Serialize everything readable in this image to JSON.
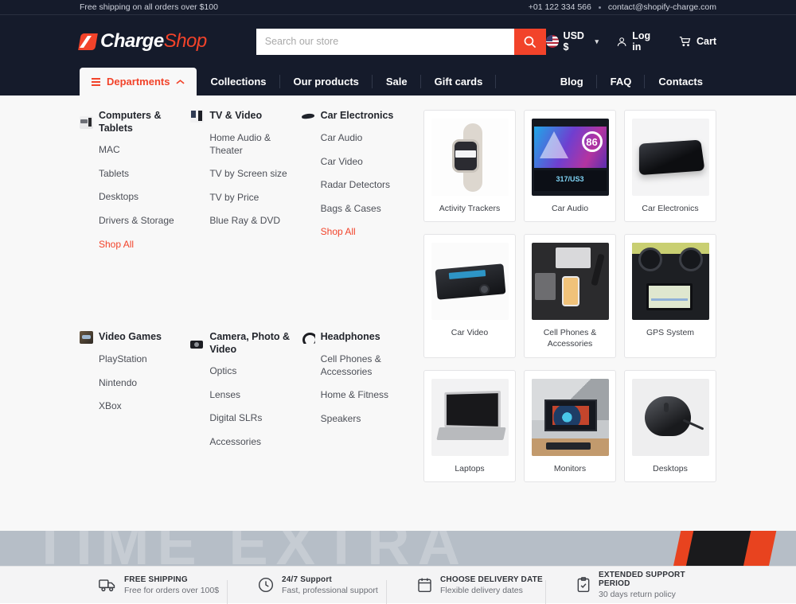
{
  "topbar": {
    "promo": "Free shipping on all orders over $100",
    "phone": "+01 122 334 566",
    "email": "contact@shopify-charge.com"
  },
  "header": {
    "logo_primary": "Charge",
    "logo_secondary": "Shop",
    "search_placeholder": "Search our store",
    "search_value": "",
    "currency": "USD $",
    "login_label": "Log in",
    "cart_label": "Cart"
  },
  "nav": {
    "departments_label": "Departments",
    "left_items": [
      {
        "label": "Collections"
      },
      {
        "label": "Our products"
      },
      {
        "label": "Sale"
      },
      {
        "label": "Gift cards"
      }
    ],
    "right_items": [
      {
        "label": "Blog"
      },
      {
        "label": "FAQ"
      },
      {
        "label": "Contacts"
      }
    ]
  },
  "mega_menu": {
    "columns": [
      {
        "title": "Computers & Tablets",
        "icon": "computers-icon",
        "links": [
          {
            "label": "MAC",
            "accent": false
          },
          {
            "label": "Tablets",
            "accent": false
          },
          {
            "label": "Desktops",
            "accent": false
          },
          {
            "label": "Drivers & Storage",
            "accent": false
          },
          {
            "label": "Shop All",
            "accent": true
          }
        ]
      },
      {
        "title": "TV & Video",
        "icon": "tv-icon",
        "links": [
          {
            "label": "Home Audio & Theater",
            "accent": false
          },
          {
            "label": "TV by Screen size",
            "accent": false
          },
          {
            "label": "TV by Price",
            "accent": false
          },
          {
            "label": "Blue Ray & DVD",
            "accent": false
          }
        ]
      },
      {
        "title": "Car Electronics",
        "icon": "car-icon",
        "links": [
          {
            "label": "Car Audio",
            "accent": false
          },
          {
            "label": "Car Video",
            "accent": false
          },
          {
            "label": "Radar Detectors",
            "accent": false
          },
          {
            "label": "Bags & Cases",
            "accent": false
          },
          {
            "label": "Shop All",
            "accent": true
          }
        ]
      },
      {
        "title": "Video Games",
        "icon": "games-icon",
        "links": [
          {
            "label": "PlayStation",
            "accent": false
          },
          {
            "label": "Nintendo",
            "accent": false
          },
          {
            "label": "XBox",
            "accent": false
          }
        ]
      },
      {
        "title": "Camera, Photo & Video",
        "icon": "camera-icon",
        "links": [
          {
            "label": "Optics",
            "accent": false
          },
          {
            "label": "Lenses",
            "accent": false
          },
          {
            "label": "Digital SLRs",
            "accent": false
          },
          {
            "label": "Accessories",
            "accent": false
          }
        ]
      },
      {
        "title": "Headphones",
        "icon": "headphones-icon",
        "links": [
          {
            "label": "Cell Phones & Accessories",
            "accent": false
          },
          {
            "label": "Home & Fitness",
            "accent": false
          },
          {
            "label": "Speakers",
            "accent": false
          }
        ]
      }
    ],
    "cards": [
      {
        "label": "Activity Trackers",
        "thumb": "watch"
      },
      {
        "label": "Car Audio",
        "thumb": "caraudio"
      },
      {
        "label": "Car Electronics",
        "thumb": "carelec"
      },
      {
        "label": "Car Video",
        "thumb": "carvideo"
      },
      {
        "label": "Cell Phones & Accessories",
        "thumb": "cell"
      },
      {
        "label": "GPS System",
        "thumb": "gps"
      },
      {
        "label": "Laptops",
        "thumb": "laptop"
      },
      {
        "label": "Monitors",
        "thumb": "monitor"
      },
      {
        "label": "Desktops",
        "thumb": "mouse"
      }
    ]
  },
  "hero": {
    "ghost_text": "TIME EXTRA"
  },
  "features": [
    {
      "icon": "truck-icon",
      "title": "FREE SHIPPING",
      "subtitle": "Free for orders over 100$"
    },
    {
      "icon": "clock-icon",
      "title": "24/7 Support",
      "subtitle": "Fast, professional support"
    },
    {
      "icon": "calendar-icon",
      "title": "CHOOSE DELIVERY DATE",
      "subtitle": "Flexible delivery dates"
    },
    {
      "icon": "clipboard-check-icon",
      "title": "EXTENDED SUPPORT PERIOD",
      "subtitle": "30 days return policy"
    }
  ],
  "colors": {
    "brand_red": "#f2432a",
    "header_dark": "#151b2b",
    "panel_bg": "#f8f8f8"
  }
}
